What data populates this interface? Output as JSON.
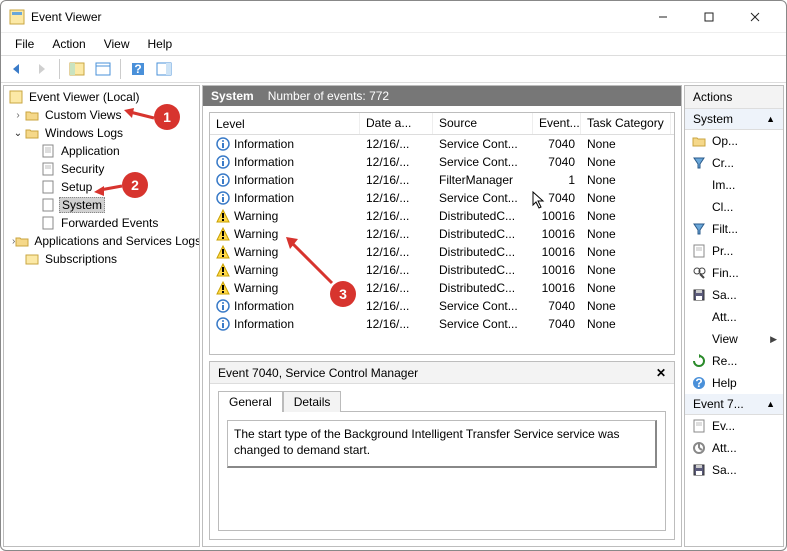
{
  "window": {
    "title": "Event Viewer"
  },
  "menu": {
    "file": "File",
    "action": "Action",
    "view": "View",
    "help": "Help"
  },
  "tree": {
    "root": "Event Viewer (Local)",
    "custom_views": "Custom Views",
    "windows_logs": "Windows Logs",
    "application": "Application",
    "security": "Security",
    "setup": "Setup",
    "system": "System",
    "forwarded": "Forwarded Events",
    "apps_services": "Applications and Services Logs",
    "subscriptions": "Subscriptions"
  },
  "center": {
    "heading": "System",
    "count_label": "Number of events: 772"
  },
  "columns": {
    "level": "Level",
    "date": "Date a...",
    "source": "Source",
    "event": "Event...",
    "task": "Task Category"
  },
  "rows": [
    {
      "level": "Information",
      "icon": "info",
      "date": "12/16/...",
      "source": "Service Cont...",
      "event": "7040",
      "task": "None"
    },
    {
      "level": "Information",
      "icon": "info",
      "date": "12/16/...",
      "source": "Service Cont...",
      "event": "7040",
      "task": "None"
    },
    {
      "level": "Information",
      "icon": "info",
      "date": "12/16/...",
      "source": "FilterManager",
      "event": "1",
      "task": "None"
    },
    {
      "level": "Information",
      "icon": "info",
      "date": "12/16/...",
      "source": "Service Cont...",
      "event": "7040",
      "task": "None"
    },
    {
      "level": "Warning",
      "icon": "warn",
      "date": "12/16/...",
      "source": "DistributedC...",
      "event": "10016",
      "task": "None"
    },
    {
      "level": "Warning",
      "icon": "warn",
      "date": "12/16/...",
      "source": "DistributedC...",
      "event": "10016",
      "task": "None"
    },
    {
      "level": "Warning",
      "icon": "warn",
      "date": "12/16/...",
      "source": "DistributedC...",
      "event": "10016",
      "task": "None"
    },
    {
      "level": "Warning",
      "icon": "warn",
      "date": "12/16/...",
      "source": "DistributedC...",
      "event": "10016",
      "task": "None"
    },
    {
      "level": "Warning",
      "icon": "warn",
      "date": "12/16/...",
      "source": "DistributedC...",
      "event": "10016",
      "task": "None"
    },
    {
      "level": "Information",
      "icon": "info",
      "date": "12/16/...",
      "source": "Service Cont...",
      "event": "7040",
      "task": "None"
    },
    {
      "level": "Information",
      "icon": "info",
      "date": "12/16/...",
      "source": "Service Cont...",
      "event": "7040",
      "task": "None"
    }
  ],
  "preview": {
    "title": "Event 7040, Service Control Manager",
    "tab_general": "General",
    "tab_details": "Details",
    "body": "The start type of the Background Intelligent Transfer Service service was changed to demand start."
  },
  "actions": {
    "title": "Actions",
    "section1": "System",
    "section2": "Event 7...",
    "items1": [
      {
        "label": "Op...",
        "icon": "folder"
      },
      {
        "label": "Cr...",
        "icon": "filter"
      },
      {
        "label": "Im...",
        "icon": "blank"
      },
      {
        "label": "Cl...",
        "icon": "blank"
      },
      {
        "label": "Filt...",
        "icon": "filter"
      },
      {
        "label": "Pr...",
        "icon": "props"
      },
      {
        "label": "Fin...",
        "icon": "find"
      },
      {
        "label": "Sa...",
        "icon": "save"
      },
      {
        "label": "Att...",
        "icon": "blank"
      },
      {
        "label": "View",
        "icon": "blank",
        "arrow": true
      },
      {
        "label": "Re...",
        "icon": "refresh"
      },
      {
        "label": "Help",
        "icon": "help"
      }
    ],
    "items2": [
      {
        "label": "Ev...",
        "icon": "props"
      },
      {
        "label": "Att...",
        "icon": "attach"
      },
      {
        "label": "Sa...",
        "icon": "save"
      }
    ]
  },
  "callouts": {
    "b1": "1",
    "b2": "2",
    "b3": "3"
  }
}
